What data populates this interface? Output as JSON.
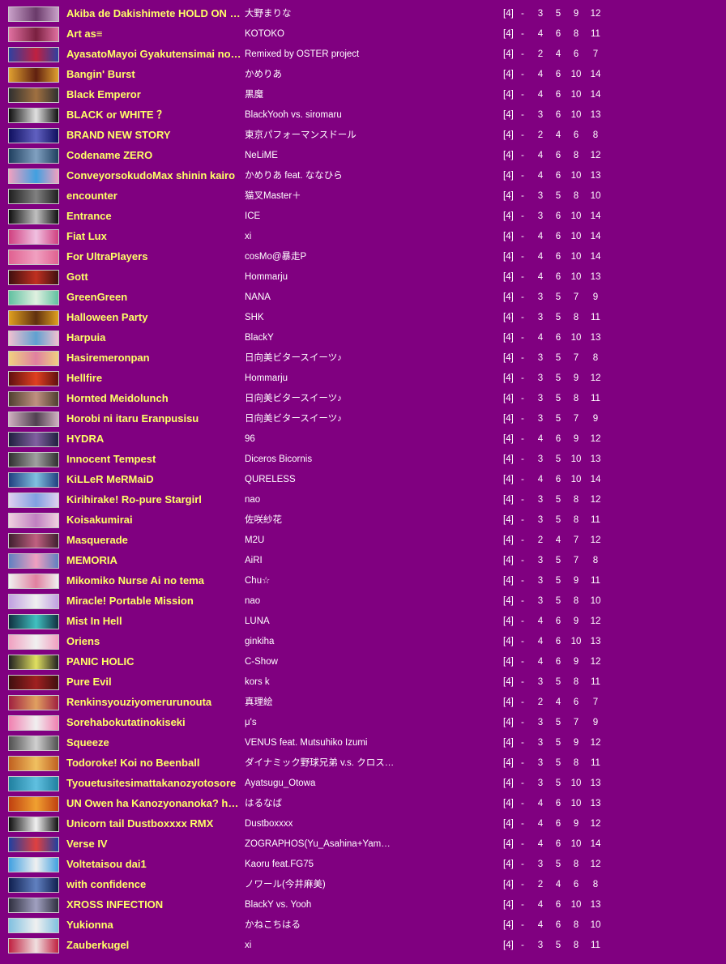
{
  "songs": [
    {
      "title": "Akiba de Dakishimete HOLD ON ME!",
      "artist": "大野まりな",
      "keys": "[4]",
      "dash": "-",
      "levels": [
        "3",
        "5",
        "9",
        "12"
      ],
      "banner": [
        "#c8a0c8",
        "#6a3a6a"
      ]
    },
    {
      "title": "Art as≡",
      "artist": "KOTOKO",
      "keys": "[4]",
      "dash": "-",
      "levels": [
        "4",
        "6",
        "8",
        "11"
      ],
      "banner": [
        "#e070a0",
        "#7a2040"
      ]
    },
    {
      "title": "AyasatoMayoi Gyakutensimai no Gyakuten",
      "artist": "Remixed by OSTER project",
      "keys": "[4]",
      "dash": "-",
      "levels": [
        "2",
        "4",
        "6",
        "7"
      ],
      "banner": [
        "#3040a0",
        "#c02040"
      ]
    },
    {
      "title": "Bangin' Burst",
      "artist": "かめりあ",
      "keys": "[4]",
      "dash": "-",
      "levels": [
        "4",
        "6",
        "10",
        "14"
      ],
      "banner": [
        "#e0a030",
        "#602010"
      ]
    },
    {
      "title": "Black Emperor",
      "artist": "黒魔",
      "keys": "[4]",
      "dash": "-",
      "levels": [
        "4",
        "6",
        "10",
        "14"
      ],
      "banner": [
        "#303030",
        "#a07040"
      ]
    },
    {
      "title": "BLACK or WHITE ？",
      "artist": "BlackYooh vs. siromaru",
      "keys": "[4]",
      "dash": "-",
      "levels": [
        "3",
        "6",
        "10",
        "13"
      ],
      "banner": [
        "#101010",
        "#e0e0e0"
      ]
    },
    {
      "title": "BRAND NEW STORY",
      "artist": "東京パフォーマンスドール",
      "keys": "[4]",
      "dash": "-",
      "levels": [
        "2",
        "4",
        "6",
        "8"
      ],
      "banner": [
        "#101060",
        "#6060c0"
      ]
    },
    {
      "title": "Codename ZERO",
      "artist": "NeLiME",
      "keys": "[4]",
      "dash": "-",
      "levels": [
        "4",
        "6",
        "8",
        "12"
      ],
      "banner": [
        "#204060",
        "#80a0c0"
      ]
    },
    {
      "title": "ConveyorsokudoMax shinin kairo",
      "artist": "かめりあ feat. ななひら",
      "keys": "[4]",
      "dash": "-",
      "levels": [
        "4",
        "6",
        "10",
        "13"
      ],
      "banner": [
        "#f0a0c0",
        "#40a0e0"
      ]
    },
    {
      "title": "encounter",
      "artist": "猫叉Master＋",
      "keys": "[4]",
      "dash": "-",
      "levels": [
        "3",
        "5",
        "8",
        "10"
      ],
      "banner": [
        "#202020",
        "#808080"
      ]
    },
    {
      "title": "Entrance",
      "artist": "ICE",
      "keys": "[4]",
      "dash": "-",
      "levels": [
        "3",
        "6",
        "10",
        "14"
      ],
      "banner": [
        "#101010",
        "#c0c0c0"
      ]
    },
    {
      "title": "Fiat Lux",
      "artist": "xi",
      "keys": "[4]",
      "dash": "-",
      "levels": [
        "4",
        "6",
        "10",
        "14"
      ],
      "banner": [
        "#d04080",
        "#f0c0e0"
      ]
    },
    {
      "title": "For UltraPlayers",
      "artist": "cosMo@暴走P",
      "keys": "[4]",
      "dash": "-",
      "levels": [
        "4",
        "6",
        "10",
        "14"
      ],
      "banner": [
        "#e06090",
        "#f0a0c0"
      ]
    },
    {
      "title": "Gott",
      "artist": "Hommarju",
      "keys": "[4]",
      "dash": "-",
      "levels": [
        "4",
        "6",
        "10",
        "13"
      ],
      "banner": [
        "#401010",
        "#c03020"
      ]
    },
    {
      "title": "GreenGreen",
      "artist": "NANA",
      "keys": "[4]",
      "dash": "-",
      "levels": [
        "3",
        "5",
        "7",
        "9"
      ],
      "banner": [
        "#60c0a0",
        "#e0f0e0"
      ]
    },
    {
      "title": "Halloween Party",
      "artist": "SHK",
      "keys": "[4]",
      "dash": "-",
      "levels": [
        "3",
        "5",
        "8",
        "11"
      ],
      "banner": [
        "#e0a020",
        "#603010"
      ]
    },
    {
      "title": "Harpuia",
      "artist": "BlackY",
      "keys": "[4]",
      "dash": "-",
      "levels": [
        "4",
        "6",
        "10",
        "13"
      ],
      "banner": [
        "#f0c0d0",
        "#60a0d0"
      ]
    },
    {
      "title": "Hasiremeronpan",
      "artist": "日向美ビタースイーツ♪",
      "keys": "[4]",
      "dash": "-",
      "levels": [
        "3",
        "5",
        "7",
        "8"
      ],
      "banner": [
        "#f0d080",
        "#e080a0"
      ]
    },
    {
      "title": "Hellfire",
      "artist": "Hommarju",
      "keys": "[4]",
      "dash": "-",
      "levels": [
        "3",
        "5",
        "9",
        "12"
      ],
      "banner": [
        "#601010",
        "#e04020"
      ]
    },
    {
      "title": "Hornted Meidolunch",
      "artist": "日向美ビタースイーツ♪",
      "keys": "[4]",
      "dash": "-",
      "levels": [
        "3",
        "5",
        "8",
        "11"
      ],
      "banner": [
        "#504030",
        "#c09080"
      ]
    },
    {
      "title": "Horobi ni itaru Eranpusisu",
      "artist": "日向美ビタースイーツ♪",
      "keys": "[4]",
      "dash": "-",
      "levels": [
        "3",
        "5",
        "7",
        "9"
      ],
      "banner": [
        "#d0b0c0",
        "#504050"
      ]
    },
    {
      "title": "HYDRA",
      "artist": "96",
      "keys": "[4]",
      "dash": "-",
      "levels": [
        "4",
        "6",
        "9",
        "12"
      ],
      "banner": [
        "#202040",
        "#8060a0"
      ]
    },
    {
      "title": "Innocent Tempest",
      "artist": "Diceros Bicornis",
      "keys": "[4]",
      "dash": "-",
      "levels": [
        "3",
        "5",
        "10",
        "13"
      ],
      "banner": [
        "#303030",
        "#a0a0a0"
      ]
    },
    {
      "title": "KiLLeR MeRMaiD",
      "artist": "QURELESS",
      "keys": "[4]",
      "dash": "-",
      "levels": [
        "4",
        "6",
        "10",
        "14"
      ],
      "banner": [
        "#204080",
        "#80c0e0"
      ]
    },
    {
      "title": "Kirihirake! Ro-pure Stargirl",
      "artist": "nao",
      "keys": "[4]",
      "dash": "-",
      "levels": [
        "3",
        "5",
        "8",
        "12"
      ],
      "banner": [
        "#e0d0f0",
        "#80a0e0"
      ]
    },
    {
      "title": "Koisakumirai",
      "artist": "佐咲紗花",
      "keys": "[4]",
      "dash": "-",
      "levels": [
        "3",
        "5",
        "8",
        "11"
      ],
      "banner": [
        "#f0d0e0",
        "#c080c0"
      ]
    },
    {
      "title": "Masquerade",
      "artist": "M2U",
      "keys": "[4]",
      "dash": "-",
      "levels": [
        "2",
        "4",
        "7",
        "12"
      ],
      "banner": [
        "#402030",
        "#c06080"
      ]
    },
    {
      "title": "MEMORIA",
      "artist": "AiRI",
      "keys": "[4]",
      "dash": "-",
      "levels": [
        "3",
        "5",
        "7",
        "8"
      ],
      "banner": [
        "#6080c0",
        "#f0a0c0"
      ]
    },
    {
      "title": "Mikomiko Nurse Ai no tema",
      "artist": "Chu☆",
      "keys": "[4]",
      "dash": "-",
      "levels": [
        "3",
        "5",
        "9",
        "11"
      ],
      "banner": [
        "#f0f0f0",
        "#e080a0"
      ]
    },
    {
      "title": "Miracle! Portable Mission",
      "artist": "nao",
      "keys": "[4]",
      "dash": "-",
      "levels": [
        "3",
        "5",
        "8",
        "10"
      ],
      "banner": [
        "#c0a0e0",
        "#f0f0f0"
      ]
    },
    {
      "title": "Mist In Hell",
      "artist": "LUNA",
      "keys": "[4]",
      "dash": "-",
      "levels": [
        "4",
        "6",
        "9",
        "12"
      ],
      "banner": [
        "#103040",
        "#40c0c0"
      ]
    },
    {
      "title": "Oriens",
      "artist": "ginkiha",
      "keys": "[4]",
      "dash": "-",
      "levels": [
        "4",
        "6",
        "10",
        "13"
      ],
      "banner": [
        "#f0a0c0",
        "#f0f0f0"
      ]
    },
    {
      "title": "PANIC HOLIC",
      "artist": "C-Show",
      "keys": "[4]",
      "dash": "-",
      "levels": [
        "4",
        "6",
        "9",
        "12"
      ],
      "banner": [
        "#202020",
        "#e0e060"
      ]
    },
    {
      "title": "Pure Evil",
      "artist": "kors k",
      "keys": "[4]",
      "dash": "-",
      "levels": [
        "3",
        "5",
        "8",
        "11"
      ],
      "banner": [
        "#401010",
        "#a02020"
      ]
    },
    {
      "title": "Renkinsyouziyomerurunouta",
      "artist": "真理絵",
      "keys": "[4]",
      "dash": "-",
      "levels": [
        "2",
        "4",
        "6",
        "7"
      ],
      "banner": [
        "#a02040",
        "#e0a060"
      ]
    },
    {
      "title": "Sorehabokutatinokiseki",
      "artist": "μ's",
      "keys": "[4]",
      "dash": "-",
      "levels": [
        "3",
        "5",
        "7",
        "9"
      ],
      "banner": [
        "#f080b0",
        "#f0f0f0"
      ]
    },
    {
      "title": "Squeeze",
      "artist": "VENUS feat. Mutsuhiko Izumi",
      "keys": "[4]",
      "dash": "-",
      "levels": [
        "3",
        "5",
        "9",
        "12"
      ],
      "banner": [
        "#505050",
        "#d0d0d0"
      ]
    },
    {
      "title": "Todoroke! Koi no Beenball",
      "artist": "ダイナミック野球兄弟 v.s. クロスファイヤーズ",
      "keys": "[4]",
      "dash": "-",
      "levels": [
        "3",
        "5",
        "8",
        "11"
      ],
      "banner": [
        "#c06020",
        "#f0c060"
      ]
    },
    {
      "title": "Tyouetusitesimattakanozyotosore",
      "artist": "Ayatsugu_Otowa",
      "keys": "[4]",
      "dash": "-",
      "levels": [
        "3",
        "5",
        "10",
        "13"
      ],
      "banner": [
        "#2080a0",
        "#60c0e0"
      ]
    },
    {
      "title": "UN Owen ha Kanozyonanoka? hyper",
      "artist": "はるなば",
      "keys": "[4]",
      "dash": "-",
      "levels": [
        "4",
        "6",
        "10",
        "13"
      ],
      "banner": [
        "#c04010",
        "#f0a030"
      ]
    },
    {
      "title": "Unicorn tail Dustboxxxx RMX",
      "artist": "Dustboxxxx",
      "keys": "[4]",
      "dash": "-",
      "levels": [
        "4",
        "6",
        "9",
        "12"
      ],
      "banner": [
        "#101010",
        "#f0f0f0"
      ]
    },
    {
      "title": "Verse IV",
      "artist": "ZOGRAPHOS(Yu_Asahina+Yamajet)",
      "keys": "[4]",
      "dash": "-",
      "levels": [
        "4",
        "6",
        "10",
        "14"
      ],
      "banner": [
        "#2040a0",
        "#e04040"
      ]
    },
    {
      "title": "Voltetaisou dai1",
      "artist": "Kaoru feat.FG75",
      "keys": "[4]",
      "dash": "-",
      "levels": [
        "3",
        "5",
        "8",
        "12"
      ],
      "banner": [
        "#40a0e0",
        "#f0f0f0"
      ]
    },
    {
      "title": "with confidence",
      "artist": "ノワール(今井麻美)",
      "keys": "[4]",
      "dash": "-",
      "levels": [
        "2",
        "4",
        "6",
        "8"
      ],
      "banner": [
        "#102050",
        "#6080c0"
      ]
    },
    {
      "title": "XROSS INFECTION",
      "artist": "BlackY vs. Yooh",
      "keys": "[4]",
      "dash": "-",
      "levels": [
        "4",
        "6",
        "10",
        "13"
      ],
      "banner": [
        "#303040",
        "#a0a0c0"
      ]
    },
    {
      "title": "Yukionna",
      "artist": "かねこちはる",
      "keys": "[4]",
      "dash": "-",
      "levels": [
        "4",
        "6",
        "8",
        "10"
      ],
      "banner": [
        "#80c0e0",
        "#f0f0f0"
      ]
    },
    {
      "title": "Zauberkugel",
      "artist": "xi",
      "keys": "[4]",
      "dash": "-",
      "levels": [
        "3",
        "5",
        "8",
        "11"
      ],
      "banner": [
        "#c02040",
        "#f0e0e0"
      ]
    }
  ]
}
